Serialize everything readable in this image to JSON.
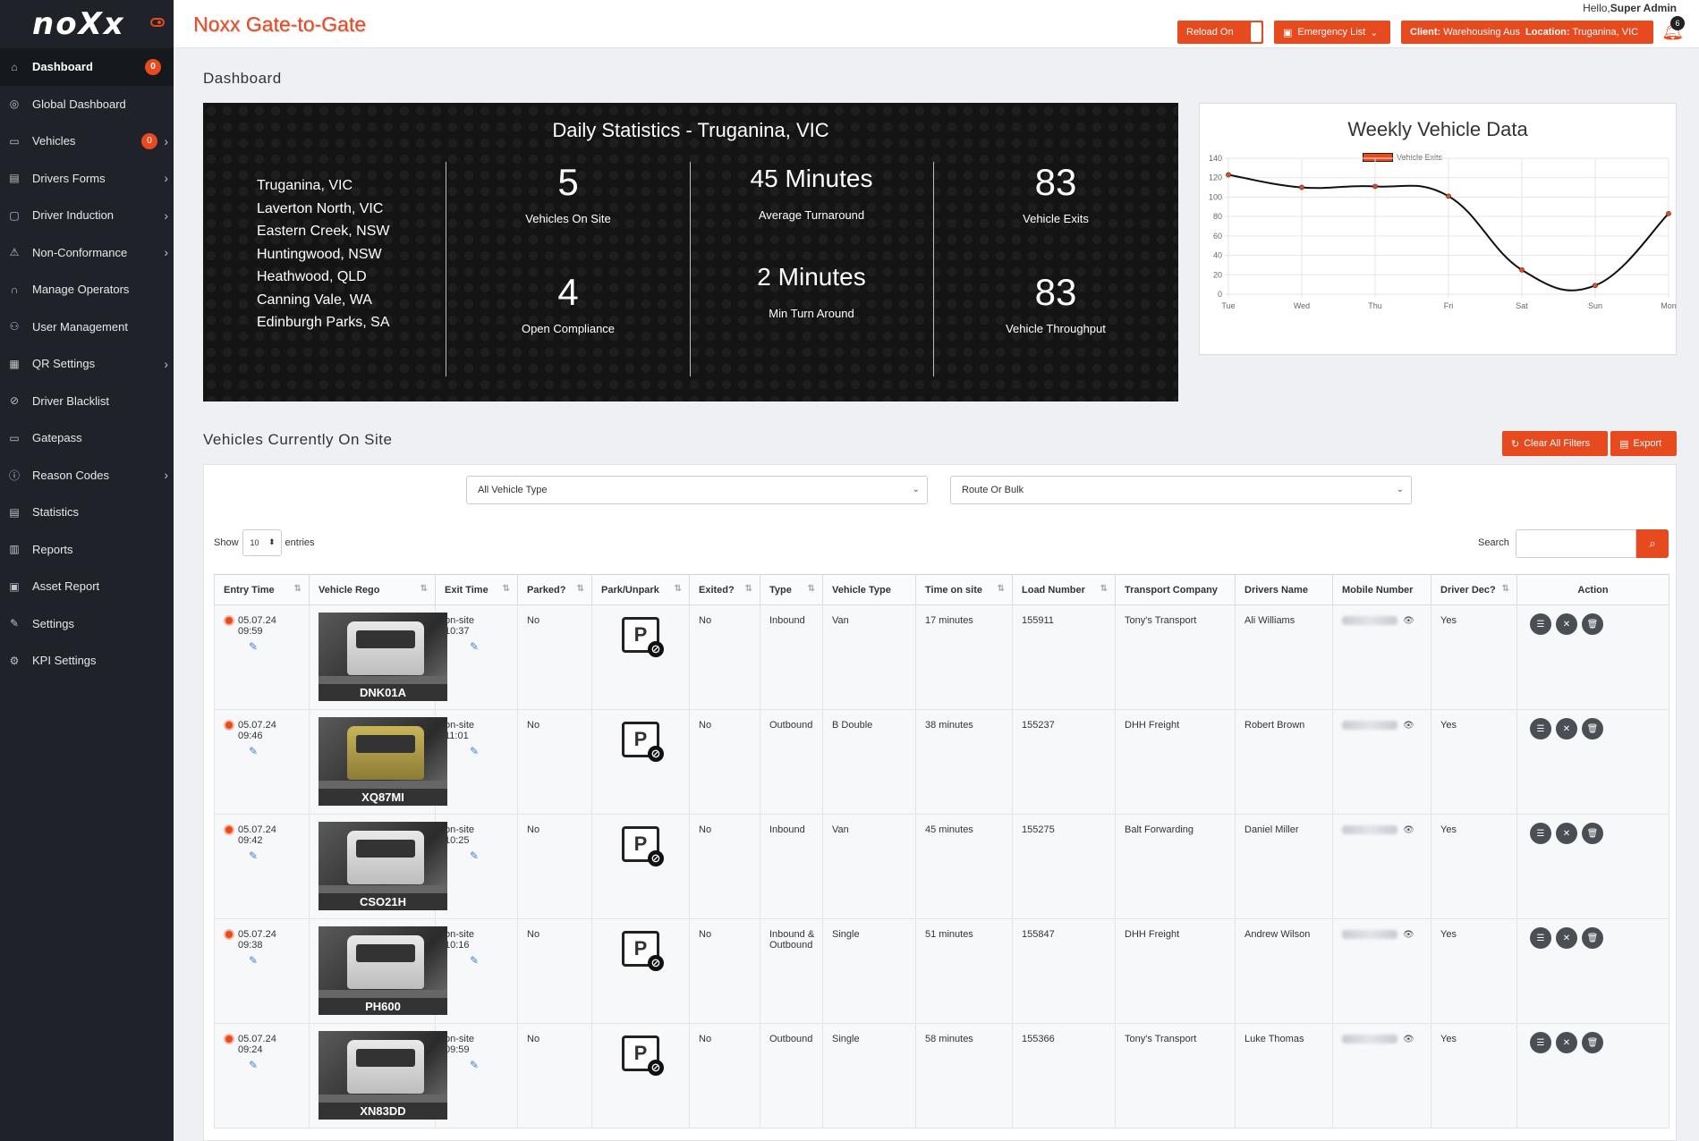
{
  "brand": {
    "logo": "noXx",
    "title": "Noxx Gate-to-Gate"
  },
  "header": {
    "hello_prefix": "Hello,",
    "user": "Super Admin",
    "reload_label": "Reload On",
    "emergency_label": "Emergency List",
    "client_label": "Client:",
    "client_value": "Warehousing Aus",
    "location_label": "Location:",
    "location_value": "Truganina, VIC",
    "notifications": "6",
    "accent": "#e84a1f"
  },
  "sidebar": {
    "items": [
      {
        "label": "Dashboard",
        "icon": "home-icon",
        "badge": "0",
        "chevron": false,
        "active": true
      },
      {
        "label": "Global Dashboard",
        "icon": "globe-icon",
        "badge": "",
        "chevron": false
      },
      {
        "label": "Vehicles",
        "icon": "truck-icon",
        "badge": "0",
        "chevron": true
      },
      {
        "label": "Drivers Forms",
        "icon": "form-icon",
        "badge": "",
        "chevron": true
      },
      {
        "label": "Driver Induction",
        "icon": "induction-icon",
        "badge": "",
        "chevron": true
      },
      {
        "label": "Non-Conformance",
        "icon": "warning-icon",
        "badge": "",
        "chevron": true
      },
      {
        "label": "Manage Operators",
        "icon": "headset-icon",
        "badge": "",
        "chevron": false
      },
      {
        "label": "User Management",
        "icon": "users-icon",
        "badge": "",
        "chevron": false
      },
      {
        "label": "QR Settings",
        "icon": "qr-icon",
        "badge": "",
        "chevron": true
      },
      {
        "label": "Driver Blacklist",
        "icon": "blacklist-icon",
        "badge": "",
        "chevron": false
      },
      {
        "label": "Gatepass",
        "icon": "ticket-icon",
        "badge": "",
        "chevron": false
      },
      {
        "label": "Reason Codes",
        "icon": "info-icon",
        "badge": "",
        "chevron": true
      },
      {
        "label": "Statistics",
        "icon": "statistics-icon",
        "badge": "",
        "chevron": false
      },
      {
        "label": "Reports",
        "icon": "bar-chart-icon",
        "badge": "",
        "chevron": false
      },
      {
        "label": "Asset Report",
        "icon": "asset-icon",
        "badge": "",
        "chevron": false
      },
      {
        "label": "Settings",
        "icon": "wrench-icon",
        "badge": "",
        "chevron": false
      },
      {
        "label": "KPI Settings",
        "icon": "gear-icon",
        "badge": "",
        "chevron": false
      }
    ]
  },
  "dashboard": {
    "page_title": "Dashboard",
    "daily": {
      "title": "Daily Statistics - Truganina, VIC",
      "locations": [
        "Truganina, VIC",
        "Laverton North, VIC",
        "Eastern Creek, NSW",
        "Huntingwood, NSW",
        "Heathwood, QLD",
        "Canning Vale, WA",
        "Edinburgh Parks, SA"
      ],
      "vehicles_on_site": {
        "value": "5",
        "label": "Vehicles On Site"
      },
      "open_compliance": {
        "value": "4",
        "label": "Open Compliance"
      },
      "avg_turnaround": {
        "value": "45 Minutes",
        "label": "Average Turnaround"
      },
      "min_turnaround": {
        "value": "2 Minutes",
        "label": "Min Turn Around"
      },
      "vehicle_exits": {
        "value": "83",
        "label": "Vehicle Exits"
      },
      "vehicle_throughput": {
        "value": "83",
        "label": "Vehicle Throughput"
      }
    }
  },
  "chart_data": {
    "type": "line",
    "title": "Weekly Vehicle Data",
    "categories": [
      "Tue",
      "Wed",
      "Thu",
      "Fri",
      "Sat",
      "Sun",
      "Mon"
    ],
    "series": [
      {
        "name": "Vehicle Exits",
        "values": [
          123,
          110,
          111,
          101,
          25,
          9,
          83
        ]
      }
    ],
    "y_ticks": [
      "0",
      "20",
      "40",
      "60",
      "80",
      "100",
      "120",
      "140"
    ],
    "ylim": [
      0,
      140
    ],
    "grid": true,
    "legend": "top-left",
    "series_color": "#e84a1f",
    "line_color": "#111111"
  },
  "vehicles": {
    "title": "Vehicles Currently On Site",
    "clear_label": "Clear All Filters",
    "export_label": "Export",
    "filter_vehicle_type": "All Vehicle Type",
    "filter_route": "Route Or Bulk",
    "show_label": "Show",
    "entries_value": "10",
    "entries_label": "entries",
    "search_label": "Search",
    "columns": [
      "Entry Time",
      "Vehicle Rego",
      "Exit Time",
      "Parked?",
      "Park/Unpark",
      "Exited?",
      "Type",
      "Vehicle Type",
      "Time on site",
      "Load Number",
      "Transport Company",
      "Drivers Name",
      "Mobile Number",
      "Driver Dec?",
      "Action"
    ],
    "rows": [
      {
        "entry_date": "05.07.24",
        "entry_time": "09:59",
        "rego": "DNK01A",
        "photo": "white",
        "exit_status": "on-site",
        "exit_time": "10:37",
        "parked": "No",
        "exited": "No",
        "type": "Inbound",
        "vehicle_type": "Van",
        "time_on_site": "17 minutes",
        "load": "155911",
        "company": "Tony's Transport",
        "driver": "Ali Williams",
        "dec": "Yes"
      },
      {
        "entry_date": "05.07.24",
        "entry_time": "09:46",
        "rego": "XQ87MI",
        "photo": "yellow",
        "exit_status": "on-site",
        "exit_time": "11:01",
        "parked": "No",
        "exited": "No",
        "type": "Outbound",
        "vehicle_type": "B Double",
        "time_on_site": "38 minutes",
        "load": "155237",
        "company": "DHH Freight",
        "driver": "Robert Brown",
        "dec": "Yes"
      },
      {
        "entry_date": "05.07.24",
        "entry_time": "09:42",
        "rego": "CSO21H",
        "photo": "white",
        "exit_status": "on-site",
        "exit_time": "10:25",
        "parked": "No",
        "exited": "No",
        "type": "Inbound",
        "vehicle_type": "Van",
        "time_on_site": "45 minutes",
        "load": "155275",
        "company": "Balt Forwarding",
        "driver": "Daniel Miller",
        "dec": "Yes"
      },
      {
        "entry_date": "05.07.24",
        "entry_time": "09:38",
        "rego": "PH600",
        "photo": "white",
        "exit_status": "on-site",
        "exit_time": "10:16",
        "parked": "No",
        "exited": "No",
        "type": "Inbound & Outbound",
        "vehicle_type": "Single",
        "time_on_site": "51 minutes",
        "load": "155847",
        "company": "DHH Freight",
        "driver": "Andrew Wilson",
        "dec": "Yes"
      },
      {
        "entry_date": "05.07.24",
        "entry_time": "09:24",
        "rego": "XN83DD",
        "photo": "white",
        "exit_status": "on-site",
        "exit_time": "09:59",
        "parked": "No",
        "exited": "No",
        "type": "Outbound",
        "vehicle_type": "Single",
        "time_on_site": "58 minutes",
        "load": "155366",
        "company": "Tony's Transport",
        "driver": "Luke Thomas",
        "dec": "Yes"
      }
    ]
  }
}
